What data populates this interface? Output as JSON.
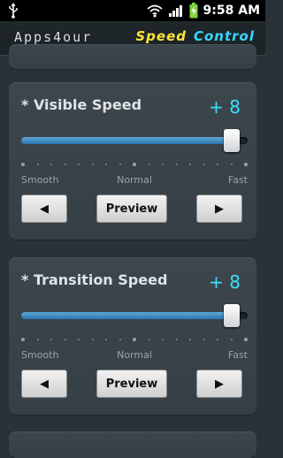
{
  "status_bar": {
    "time": "9:58 AM",
    "icons": [
      "usb-icon",
      "wifi-icon",
      "signal-icon",
      "battery-charging-icon"
    ]
  },
  "header": {
    "logo": "Apps4our",
    "title_part1": "Speed",
    "title_part2": "Control",
    "colors": {
      "title_part1": "#ffe53b",
      "title_part2": "#36d7ff"
    }
  },
  "panels": [
    {
      "title": "*  Visible Speed",
      "value": "+ 8",
      "slider_level_fraction": 0.93,
      "labels": {
        "left": "Smooth",
        "middle": "Normal",
        "right": "Fast"
      },
      "buttons": {
        "prev": "◀",
        "preview": "Preview",
        "next": "▶"
      }
    },
    {
      "title": "*  Transition Speed",
      "value": "+ 8",
      "slider_level_fraction": 0.93,
      "labels": {
        "left": "Smooth",
        "middle": "Normal",
        "right": "Fast"
      },
      "buttons": {
        "prev": "◀",
        "preview": "Preview",
        "next": "▶"
      }
    }
  ],
  "colors": {
    "accent": "#37e0ff",
    "slider_fill": "#2b74ad",
    "background": "#2b3237"
  }
}
